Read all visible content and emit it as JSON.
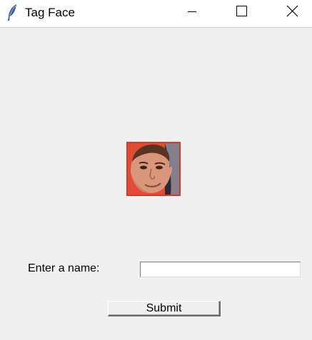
{
  "window": {
    "title": "Tag Face"
  },
  "icons": {
    "app": "feather-icon",
    "minimize": "minimize-icon",
    "maximize": "maximize-icon",
    "close": "close-icon"
  },
  "form": {
    "name_label": "Enter a name:",
    "name_value": "",
    "name_placeholder": "",
    "submit_label": "Submit"
  },
  "colors": {
    "window_bg": "#f0f0f0",
    "titlebar_bg": "#ffffff",
    "face_border": "#d43a2a"
  }
}
